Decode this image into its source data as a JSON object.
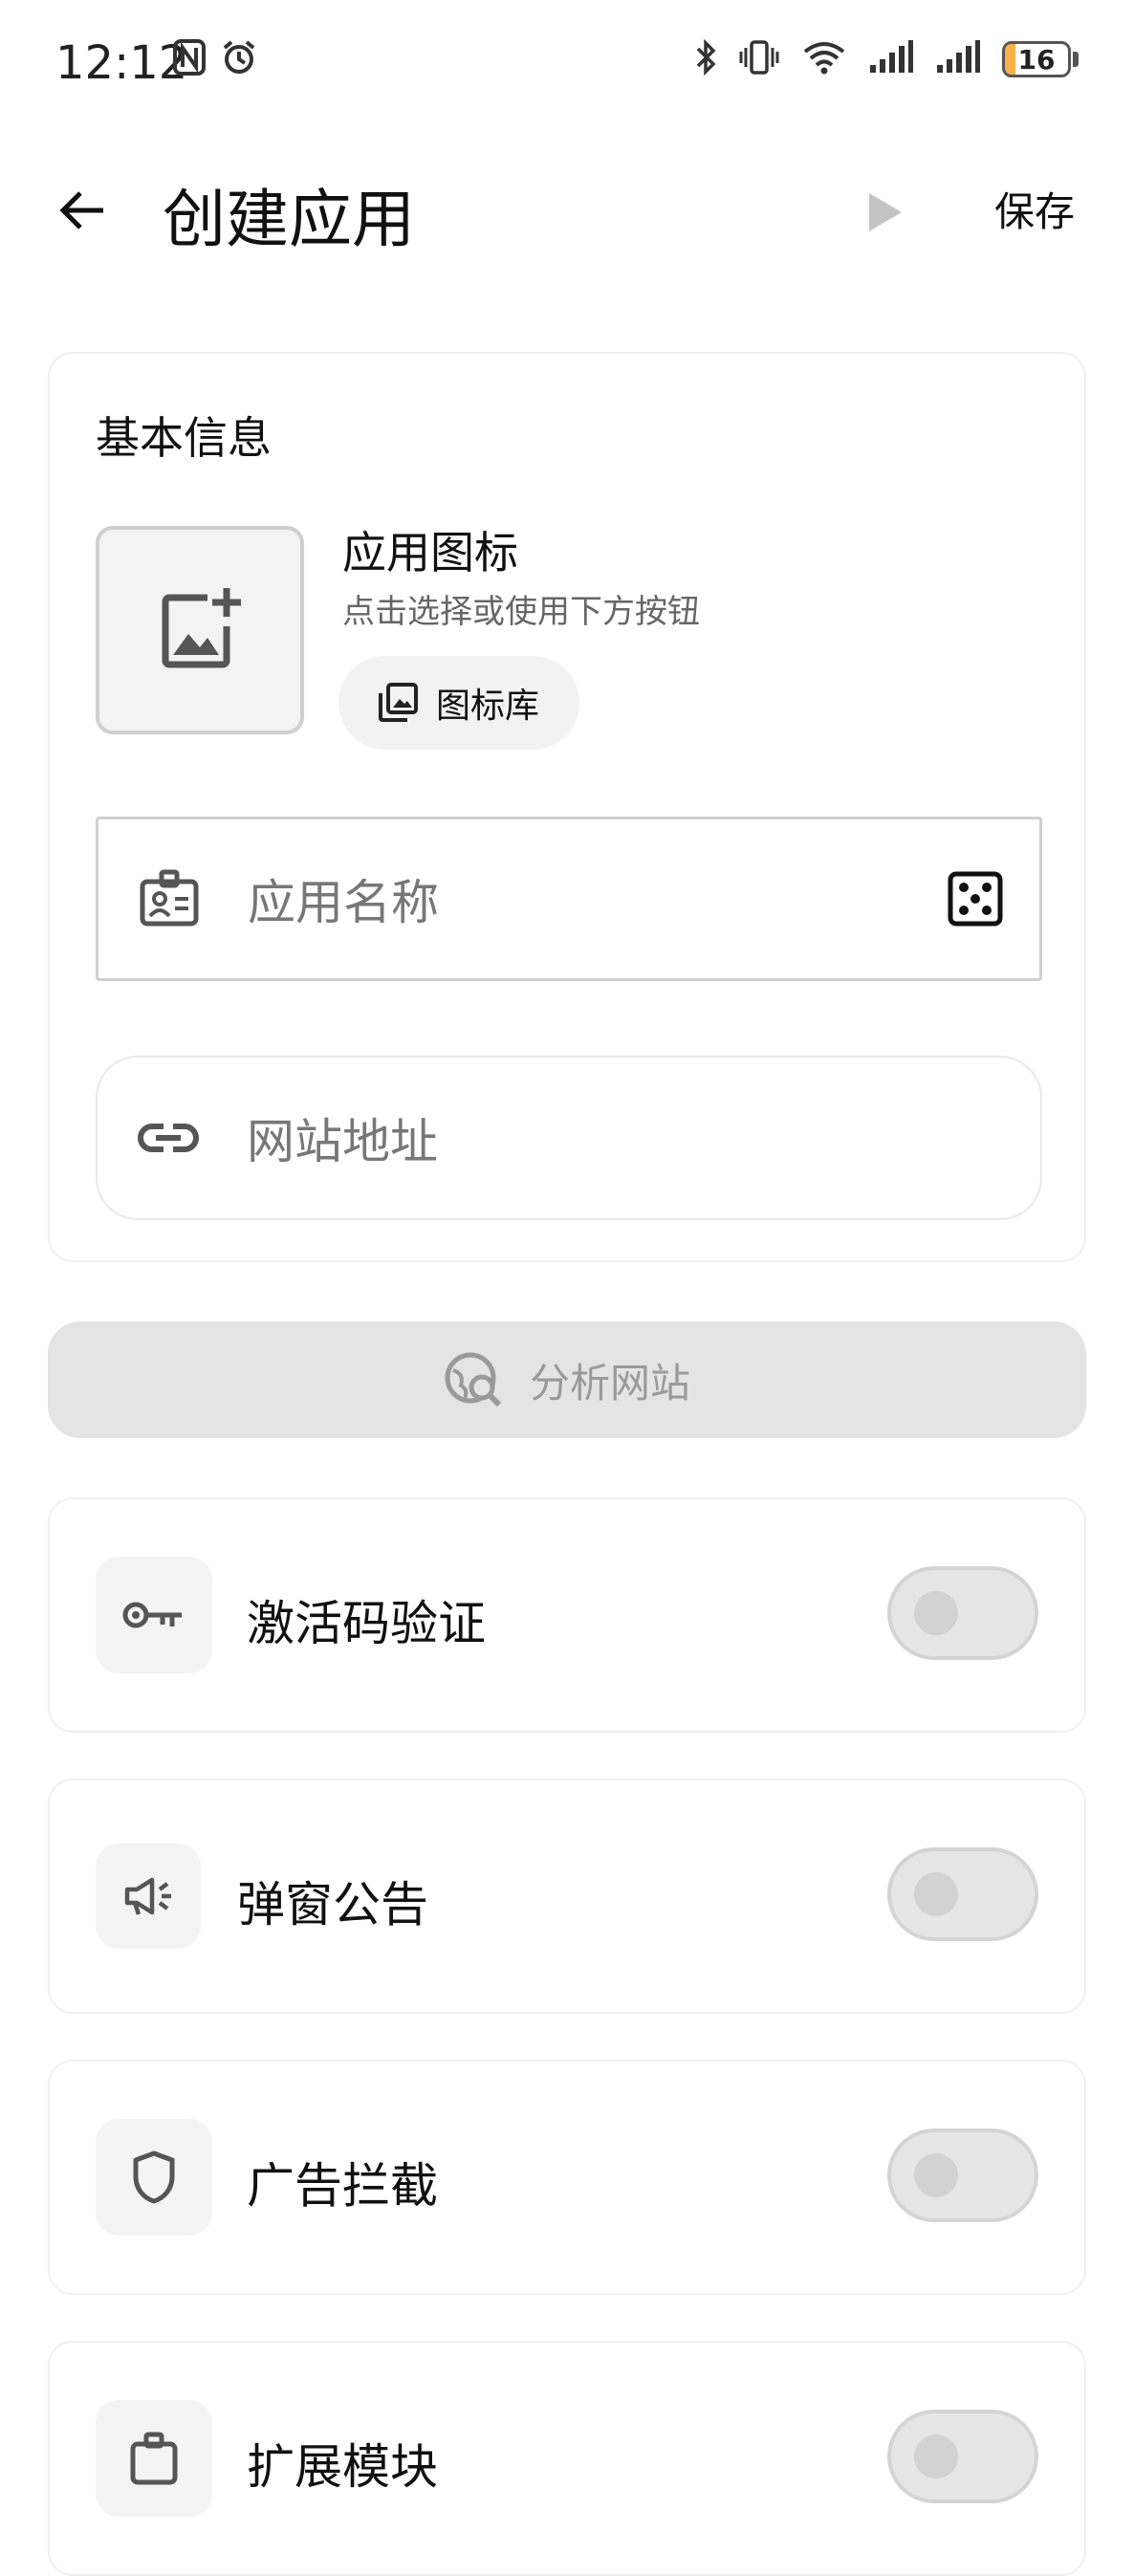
{
  "status_bar": {
    "time": "12:12",
    "battery_level": "16",
    "battery_fraction": 0.16,
    "icons": [
      "nfc-icon",
      "alarm-icon",
      "bluetooth-icon",
      "vibrate-icon",
      "wifi-icon",
      "signal-icon",
      "signal-icon",
      "battery-icon"
    ]
  },
  "app_bar": {
    "title": "创建应用",
    "save_label": "保存"
  },
  "basic_info": {
    "section_title": "基本信息",
    "icon_label": "应用图标",
    "icon_hint": "点击选择或使用下方按钮",
    "icon_library_label": "图标库",
    "name_placeholder": "应用名称",
    "url_placeholder": "网站地址"
  },
  "analyze_button": {
    "label": "分析网站"
  },
  "toggles": [
    {
      "label": "激活码验证",
      "icon": "key-icon",
      "enabled": false
    },
    {
      "label": "弹窗公告",
      "icon": "megaphone-icon",
      "enabled": false
    },
    {
      "label": "广告拦截",
      "icon": "shield-icon",
      "enabled": false
    },
    {
      "label": "扩展模块",
      "icon": "extension-icon",
      "enabled": false
    }
  ],
  "colors": {
    "battery_fill": "#f7b04a",
    "disabled_button": "#e4e4e4",
    "switch_off": "#e6e6e6"
  }
}
